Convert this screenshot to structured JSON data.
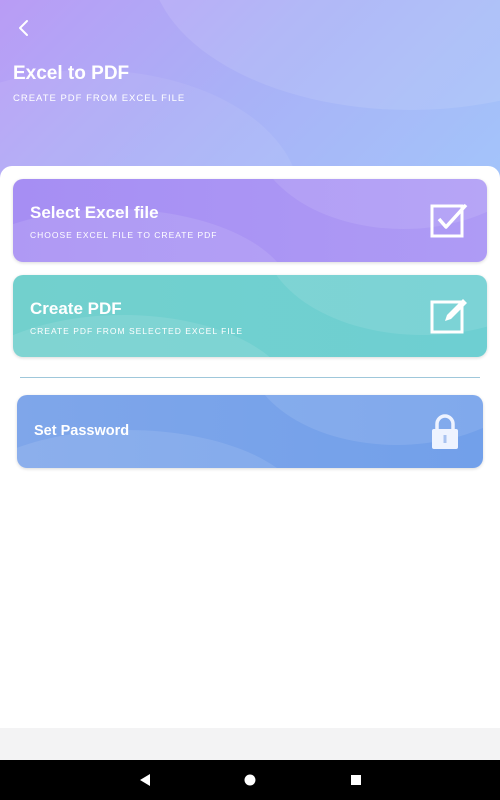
{
  "header": {
    "title": "Excel to PDF",
    "subtitle": "CREATE PDF FROM EXCEL FILE",
    "back_icon": "chevron-left-icon"
  },
  "actions": [
    {
      "title": "Select Excel file",
      "subtitle": "CHOOSE EXCEL FILE TO CREATE PDF",
      "icon": "checkbox-checked-icon",
      "color": "#a98ff3"
    },
    {
      "title": "Create PDF",
      "subtitle": "CREATE PDF FROM SELECTED EXCEL FILE",
      "icon": "edit-pencil-icon",
      "color": "#72d0cd"
    },
    {
      "title": "Set Password",
      "icon": "lock-icon",
      "color": "#76a3ea"
    }
  ],
  "navbar": {
    "back_icon": "nav-back-triangle-icon",
    "home_icon": "nav-home-circle-icon",
    "recents_icon": "nav-recents-square-icon"
  }
}
